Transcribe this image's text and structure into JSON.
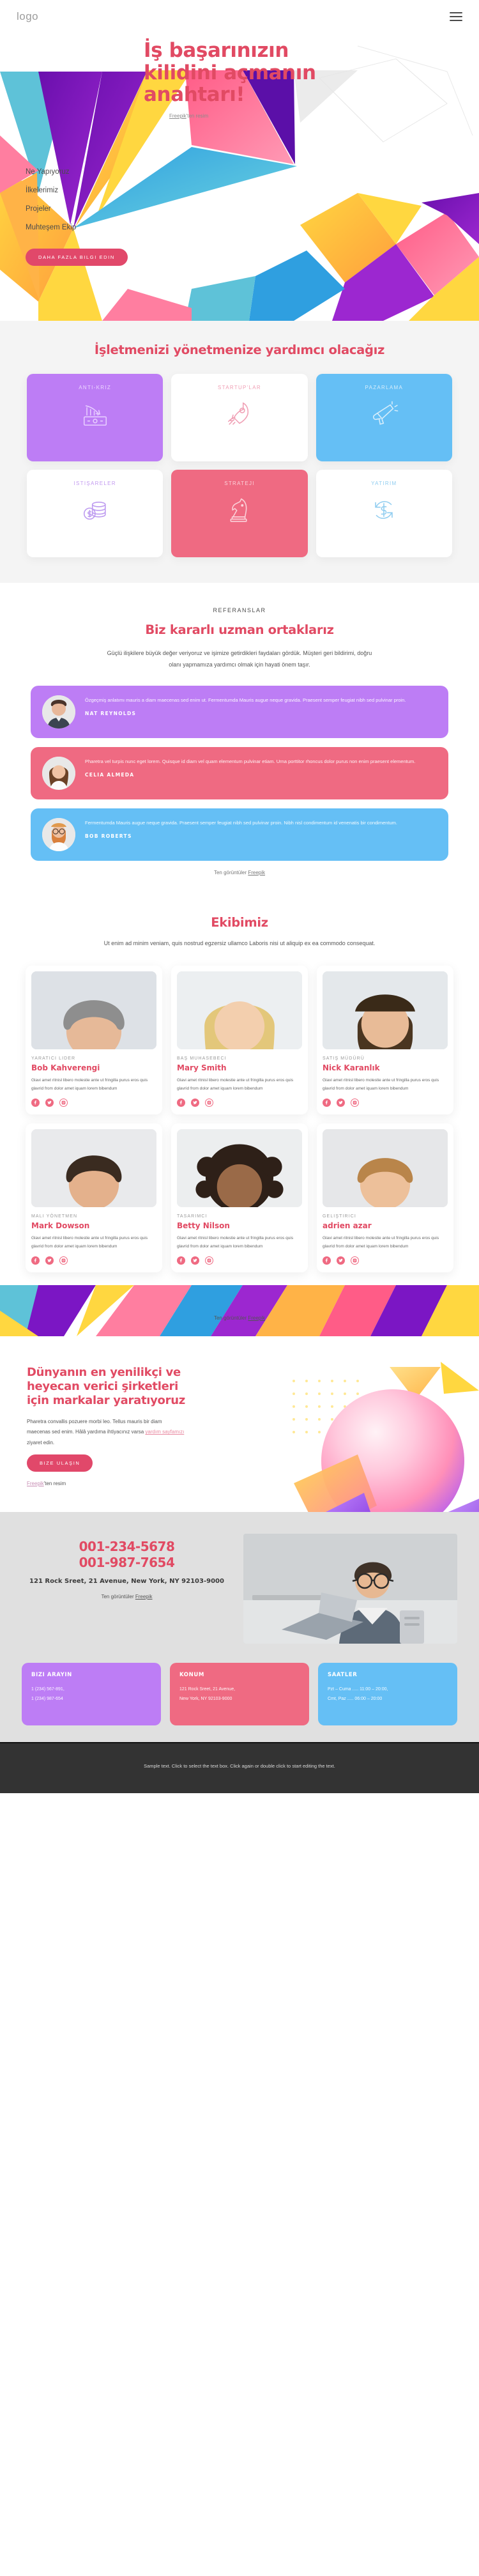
{
  "header": {
    "logo": "logo",
    "menu_icon": "hamburger-icon"
  },
  "hero": {
    "title": "İş başarınızın kilidini açmanın anahtarı!",
    "credit_prefix": "",
    "credit_link": "Freepik",
    "credit_suffix": "'ten resim",
    "nav": [
      {
        "label": "Ne Yapıyoruz"
      },
      {
        "label": "İlkelerimiz"
      },
      {
        "label": "Projeler"
      },
      {
        "label": "Muhteşem Ekip"
      }
    ],
    "cta_label": "DAHA FAZLA BILGI EDIN"
  },
  "services": {
    "title": "İşletmenizi yönetmenize yardımcı olacağız",
    "cards": [
      {
        "label": "ANTI-KRIZ",
        "icon": "chart-decline-money-icon",
        "style": "c-purple"
      },
      {
        "label": "STARTUP'LAR",
        "icon": "rocket-icon",
        "style": "c-white pk"
      },
      {
        "label": "PAZARLAMA",
        "icon": "megaphone-icon",
        "style": "c-blue"
      },
      {
        "label": "ISTIŞARELER",
        "icon": "coins-dollar-icon",
        "style": "c-white pp"
      },
      {
        "label": "STRATEJI",
        "icon": "chess-knight-icon",
        "style": "c-pink"
      },
      {
        "label": "YATIRIM",
        "icon": "dollar-refresh-icon",
        "style": "c-white bl"
      }
    ]
  },
  "testimonials": {
    "eyebrow": "REFERANSLAR",
    "title": "Biz kararlı uzman ortaklarız",
    "subtitle": "Güçlü ilişkilere büyük değer veriyoruz ve işimize getirdikleri faydaları gördük. Müşteri geri bildirimi, doğru olanı yapmamıza yardımcı olmak için hayati önem taşır.",
    "items": [
      {
        "quote": "Özgeçmiş anlatımı mauris a diam maecenas sed enim ut. Fermentumda Mauris augue neque gravida. Praesent semper feugiat nibh sed pulvinar proin.",
        "name": "NAT REYNOLDS",
        "style": "t-purple",
        "avatar": "man-dark-shirt-avatar"
      },
      {
        "quote": "Pharetra vel turpis nunc eget lorem. Quisque id diam vel quam elementum pulvinar etiam. Urna porttitor rhoncus dolor purus non enim praesent elementum.",
        "name": "CELIA ALMEDA",
        "style": "t-pink",
        "avatar": "woman-long-hair-avatar"
      },
      {
        "quote": "Fermentumda Mauris augue neque gravida. Praesent semper feugiat nibh sed pulvinar proin. Nibh nisl condimentum id venenatis bir condimentum.",
        "name": "BOB ROBERTS",
        "style": "t-blue",
        "avatar": "bearded-man-glasses-avatar"
      }
    ],
    "credit_prefix": "Ten görüntüler ",
    "credit_link": "Freepik"
  },
  "team": {
    "title": "Ekibimiz",
    "subtitle": "Ut enim ad minim veniam, quis nostrud egzersiz ullamco Laboris nisi ut aliquip ex ea commodo consequat.",
    "members": [
      {
        "role": "YARATICI LIDER",
        "name": "Bob Kahverengi",
        "desc": "Glavi amet ritnisl libero molestie ante ut fringilla purus eros quis glavrid from dolor amet iquam lorem bibendum",
        "photo": "man-suit-photo"
      },
      {
        "role": "BAŞ MUHASEBECI",
        "name": "Mary Smith",
        "desc": "Glavi amet ritnisl libero molestie ante ut fringilla purus eros quis glavrid from dolor amet iquam lorem bibendum",
        "photo": "blonde-woman-photo"
      },
      {
        "role": "SATIŞ MÜDÜRÜ",
        "name": "Nick Karanlık",
        "desc": "Glavi amet ritnisl libero molestie ante ut fringilla purus eros quis glavrid from dolor amet iquam lorem bibendum",
        "photo": "man-beard-blue-photo"
      },
      {
        "role": "MALI YÖNETMEN",
        "name": "Mark Dowson",
        "desc": "Glavi amet ritnisl libero molestie ante ut fringilla purus eros quis glavrid from dolor amet iquam lorem bibendum",
        "photo": "man-white-tshirt-photo"
      },
      {
        "role": "TASARIMCI",
        "name": "Betty Nilson",
        "desc": "Glavi amet ritnisl libero molestie ante ut fringilla purus eros quis glavrid from dolor amet iquam lorem bibendum",
        "photo": "curly-hair-woman-photo"
      },
      {
        "role": "GELIŞTIRICI",
        "name": "adrien azar",
        "desc": "Glavi amet ritnisl libero molestie ante ut fringilla purus eros quis glavrid from dolor amet iquam lorem bibendum",
        "photo": "young-man-hoodie-photo"
      }
    ],
    "socials": [
      "facebook-icon",
      "twitter-icon",
      "instagram-icon"
    ],
    "credit_prefix": "Ten görüntüler ",
    "credit_link": "Freepik"
  },
  "cta": {
    "title": "Dünyanın en yenilikçi ve heyecan verici şirketleri için markalar yaratıyoruz",
    "text_before": "Pharetra convallis pozuere morbi leo. Tellus mauris bir diam maecenas sed enim. Hâlâ yardıma ihtiyacınız varsa ",
    "text_link": "yardım sayfamızı",
    "text_after": " ziyaret edin.",
    "button": "BIZE ULAŞIN",
    "credit_link": "Freepik",
    "credit_suffix": "'ten resim",
    "graphic": "gradient-sphere-graphic"
  },
  "footer": {
    "phone1": "001-234-5678",
    "phone2": "001-987-7654",
    "address": "121 Rock Sreet, 21 Avenue, New York, NY 92103-9000",
    "credit_prefix": "Ten görüntüler ",
    "credit_link": "Freepik",
    "image": "man-laptop-desk-photo",
    "cards": [
      {
        "title": "BIZI ARAYIN",
        "lines": [
          "1 (234) 567-891,",
          "1 (234) 987-654"
        ],
        "style": "i-purple"
      },
      {
        "title": "KONUM",
        "lines": [
          "121 Rock Sreet, 21 Avenue,",
          "New York, NY 92103-9000"
        ],
        "style": "i-pink"
      },
      {
        "title": "SAATLER",
        "lines": [
          "Pzt – Cuma ..... 11:00 – 20:00,",
          "Cmt, Paz  ..... 06:00 – 20:00"
        ],
        "style": "i-blue"
      }
    ],
    "bottom_text": "Sample text. Click to select the text box. Click again or double click to start editing the text."
  },
  "colors": {
    "accent": "#e14a63",
    "purple": "#bd7df5",
    "pink": "#ef6a82",
    "blue": "#65bff5"
  }
}
